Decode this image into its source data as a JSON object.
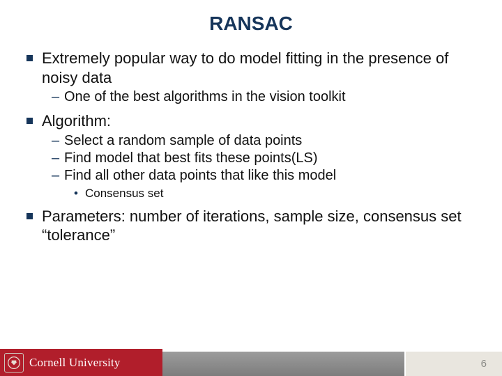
{
  "title": "RANSAC",
  "bullets": {
    "b0": "Extremely popular way to do model fitting in the presence of noisy data",
    "b0_s0": "One of the best algorithms in the vision toolkit",
    "b1": "Algorithm:",
    "b1_s0": "Select a random sample of data points",
    "b1_s1": "Find model that best fits these points(LS)",
    "b1_s2": "Find all other data points that like this model",
    "b1_s2_ss0": "Consensus set",
    "b2": "Parameters: number of iterations, sample size, consensus set “tolerance”"
  },
  "footer": {
    "brand": "Cornell University",
    "page": "6"
  }
}
